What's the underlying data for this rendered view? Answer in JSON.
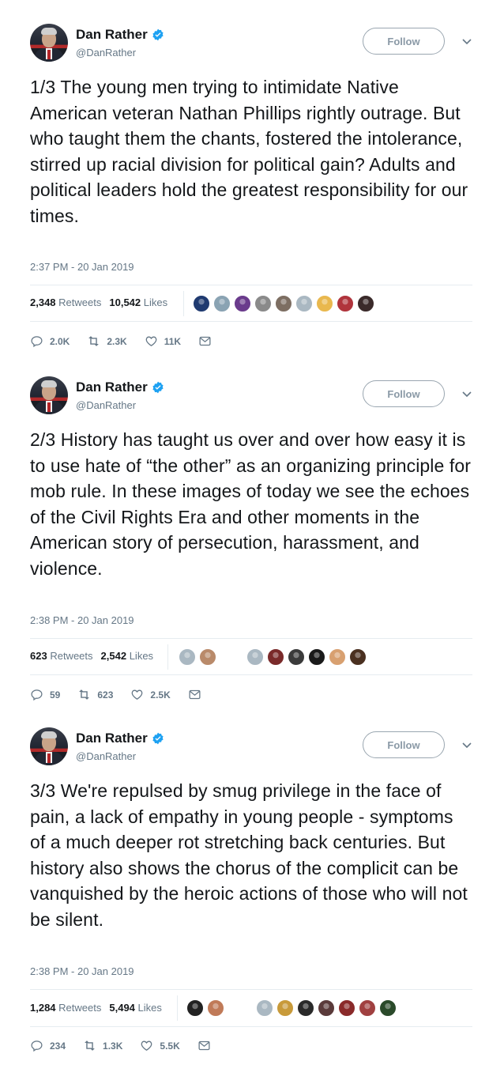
{
  "tweets": [
    {
      "name": "Dan Rather",
      "handle": "@DanRather",
      "follow_label": "Follow",
      "text": "1/3 The young men trying to intimidate Native American veteran Nathan Phillips rightly outrage. But who taught them the chants, fostered the intolerance, stirred up racial division for political gain? Adults and political leaders hold the greatest responsibility for our times.",
      "time": "2:37 PM - 20 Jan 2019",
      "retweets_count": "2,348",
      "retweets_label": "Retweets",
      "likes_count": "10,542",
      "likes_label": "Likes",
      "replies": "2.0K",
      "retweets_short": "2.3K",
      "likes_short": "11K",
      "liker_colors": [
        "#1f3a70",
        "#8aa3b3",
        "#6a3b8c",
        "#8a8a8a",
        "#7d6e62",
        "#aab8c2",
        "#e9b84e",
        "#b0343c",
        "#3a2a2a"
      ]
    },
    {
      "name": "Dan Rather",
      "handle": "@DanRather",
      "follow_label": "Follow",
      "text": "2/3 History has taught us over and over how easy it is to use hate of “the other” as an organizing principle for mob rule. In these images of today we see the echoes of the Civil Rights Era and other moments in the American story of persecution, harassment, and violence.",
      "time": "2:38 PM - 20 Jan 2019",
      "retweets_count": "623",
      "retweets_label": "Retweets",
      "likes_count": "2,542",
      "likes_label": "Likes",
      "replies": "59",
      "retweets_short": "623",
      "likes_short": "2.5K",
      "liker_colors_a": [
        "#aab8c2",
        "#b98a6a"
      ],
      "liker_colors": [
        "#aab8c2",
        "#7a2a2a",
        "#3b3b3b",
        "#1a1a1a",
        "#d8a070",
        "#4a3020"
      ]
    },
    {
      "name": "Dan Rather",
      "handle": "@DanRather",
      "follow_label": "Follow",
      "text": "3/3 We're repulsed by smug privilege in the face of pain, a lack of empathy in young people - symptoms of a much deeper rot stretching back centuries. But history also shows the chorus of the complicit can be vanquished by the heroic actions of those who will not be silent.",
      "time": "2:38 PM - 20 Jan 2019",
      "retweets_count": "1,284",
      "retweets_label": "Retweets",
      "likes_count": "5,494",
      "likes_label": "Likes",
      "replies": "234",
      "retweets_short": "1.3K",
      "likes_short": "5.5K",
      "liker_colors_a": [
        "#222222",
        "#c07a58"
      ],
      "liker_colors": [
        "#aab8c2",
        "#c89a3a",
        "#2a2a2a",
        "#5a3a3a",
        "#8a2a2a",
        "#a04040",
        "#2a4a2a"
      ]
    }
  ],
  "colors": {
    "accent": "#1da1f2",
    "muted": "#657786"
  },
  "icons": [
    "verified-icon",
    "chevron-down-icon",
    "reply-icon",
    "retweet-icon",
    "heart-icon",
    "message-icon"
  ]
}
